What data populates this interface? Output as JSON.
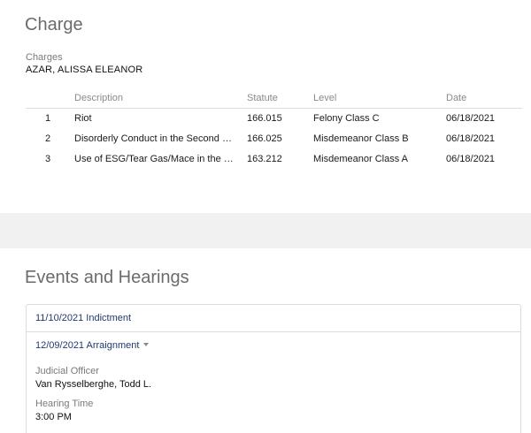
{
  "charge": {
    "title": "Charge",
    "charges_label": "Charges",
    "defendant": "AZAR, ALISSA ELEANOR",
    "table": {
      "headers": {
        "number": "",
        "description": "Description",
        "statute": "Statute",
        "level": "Level",
        "date": "Date"
      },
      "rows": [
        {
          "number": "1",
          "description": "Riot",
          "statute": "166.015",
          "level": "Felony Class C",
          "date": "06/18/2021"
        },
        {
          "number": "2",
          "description": "Disorderly Conduct in the Second De...",
          "statute": "166.025",
          "level": "Misdemeanor Class B",
          "date": "06/18/2021"
        },
        {
          "number": "3",
          "description": "Use of ESG/Tear Gas/Mace in the Se...",
          "statute": "163.212",
          "level": "Misdemeanor Class A",
          "date": "06/18/2021"
        }
      ]
    }
  },
  "events": {
    "title": "Events and Hearings",
    "items": [
      {
        "label": "11/10/2021 Indictment"
      },
      {
        "label": "12/09/2021 Arraignment",
        "expand_icon": "caret-down-icon",
        "judicial_officer_label": "Judicial Officer",
        "judicial_officer": "Van Rysselberghe, Todd L.",
        "hearing_time_label": "Hearing Time",
        "hearing_time": "3:00 PM"
      }
    ]
  },
  "colors": {
    "link": "#1f3a6e",
    "section_title": "#6b6b6b",
    "band": "#f1f1f1",
    "border": "#dcdcdc"
  }
}
